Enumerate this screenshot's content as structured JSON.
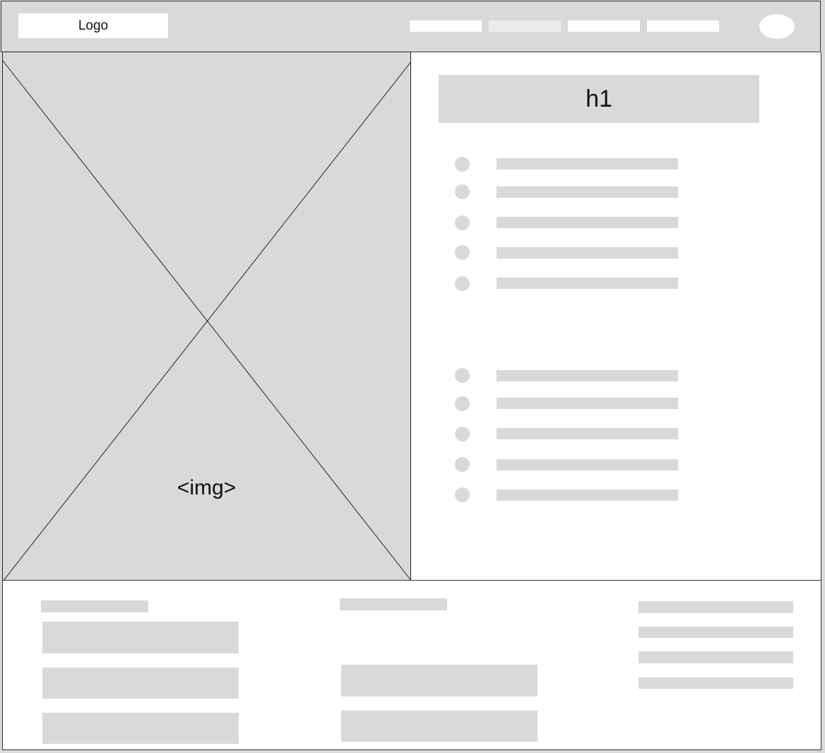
{
  "header": {
    "logo_text": "Logo",
    "nav_items": [
      "",
      "",
      "",
      ""
    ]
  },
  "hero": {
    "image_label": "<img>"
  },
  "content": {
    "heading": "h1",
    "list_group_1_count": 5,
    "list_group_2_count": 5
  },
  "colors": {
    "placeholder": "#d9d9d9",
    "background": "#ffffff",
    "border": "#333333"
  }
}
